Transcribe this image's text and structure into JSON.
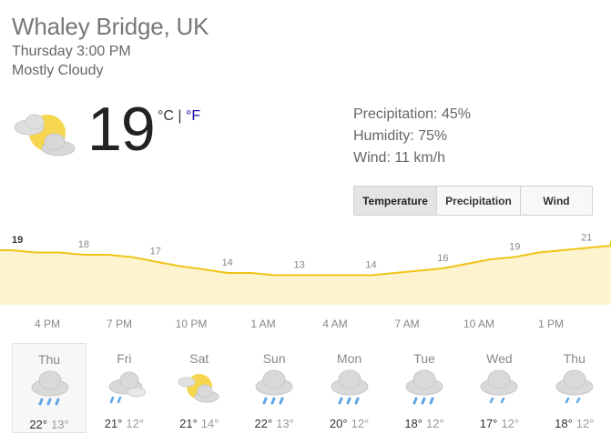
{
  "location": "Whaley Bridge, UK",
  "datetime": "Thursday 3:00 PM",
  "condition": "Mostly Cloudy",
  "current": {
    "temp": "19",
    "unit_c": "°C",
    "unit_sep": " | ",
    "unit_f": "°F",
    "icon": "partly-cloudy-icon"
  },
  "details": {
    "precipitation": "Precipitation: 45%",
    "humidity": "Humidity: 75%",
    "wind": "Wind: 11 km/h"
  },
  "tabs": [
    "Temperature",
    "Precipitation",
    "Wind"
  ],
  "active_tab": "Temperature",
  "colors": {
    "line": "#f0c419",
    "fill": "#fdf4cf",
    "link": "#1a0dab"
  },
  "chart_data": {
    "type": "area",
    "title": "",
    "xlabel": "",
    "ylabel": "",
    "x": [
      "4 PM",
      "7 PM",
      "10 PM",
      "1 AM",
      "4 AM",
      "7 AM",
      "10 AM",
      "1 PM"
    ],
    "curve": [
      19,
      18.5,
      18.5,
      18,
      18,
      17.5,
      16.5,
      15.5,
      14.8,
      14,
      14,
      13.5,
      13.5,
      13.5,
      13.5,
      13.5,
      14,
      14.5,
      15,
      16,
      17,
      17.5,
      18.5,
      19,
      19.5,
      20,
      20.5,
      21
    ],
    "labels": [
      {
        "index": 0,
        "value": "19"
      },
      {
        "index": 3,
        "value": "18"
      },
      {
        "index": 6,
        "value": "17"
      },
      {
        "index": 9,
        "value": "14"
      },
      {
        "index": 12,
        "value": "13"
      },
      {
        "index": 15,
        "value": "14"
      },
      {
        "index": 18,
        "value": "16"
      },
      {
        "index": 21,
        "value": "19"
      },
      {
        "index": 24,
        "value": "21"
      }
    ],
    "ylim": [
      8,
      22
    ],
    "unit": "°C"
  },
  "daily": [
    {
      "name": "Thu",
      "high": "22°",
      "low": "13°",
      "icon": "rain-icon",
      "selected": true
    },
    {
      "name": "Fri",
      "high": "21°",
      "low": "12°",
      "icon": "cloud-rain-light-icon",
      "selected": false
    },
    {
      "name": "Sat",
      "high": "21°",
      "low": "14°",
      "icon": "partly-cloudy-icon",
      "selected": false
    },
    {
      "name": "Sun",
      "high": "22°",
      "low": "13°",
      "icon": "rain-icon",
      "selected": false
    },
    {
      "name": "Mon",
      "high": "20°",
      "low": "12°",
      "icon": "rain-icon",
      "selected": false
    },
    {
      "name": "Tue",
      "high": "18°",
      "low": "12°",
      "icon": "rain-icon",
      "selected": false
    },
    {
      "name": "Wed",
      "high": "17°",
      "low": "12°",
      "icon": "showers-icon",
      "selected": false
    },
    {
      "name": "Thu",
      "high": "18°",
      "low": "12°",
      "icon": "showers-icon",
      "selected": false
    }
  ]
}
